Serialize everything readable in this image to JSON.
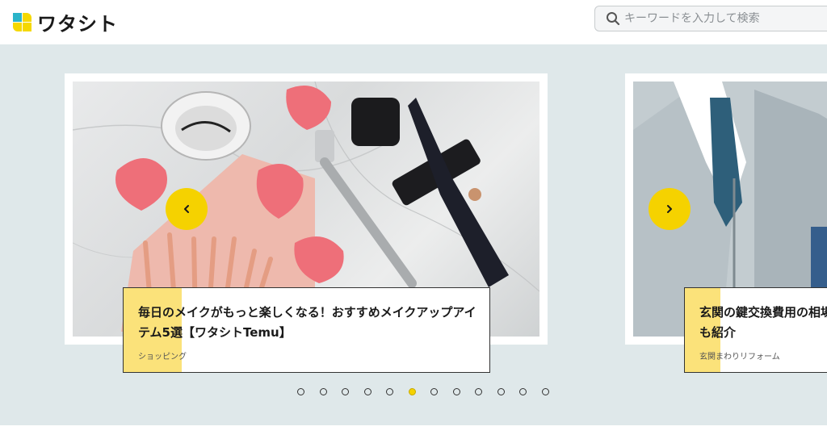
{
  "header": {
    "logo_text": "ワタシト",
    "search": {
      "placeholder": "キーワードを入力して検索"
    }
  },
  "carousel": {
    "slides": [
      {
        "title": "毎日のメイクがもっと楽しくなる！おすすめメイクアップアイテム5選【ワタシトTemu】",
        "category": "ショッピング"
      },
      {
        "title": "玄関の鍵交換費用の相場も紹介",
        "category": "玄関まわりリフォーム"
      }
    ],
    "prev_icon": "chevron-left-icon",
    "next_icon": "chevron-right-icon",
    "dot_count": 12,
    "active_dot": 5
  },
  "colors": {
    "accent": "#f5d200",
    "caption_accent": "#fbe27a",
    "hero_bg": "#dfe8ea"
  }
}
